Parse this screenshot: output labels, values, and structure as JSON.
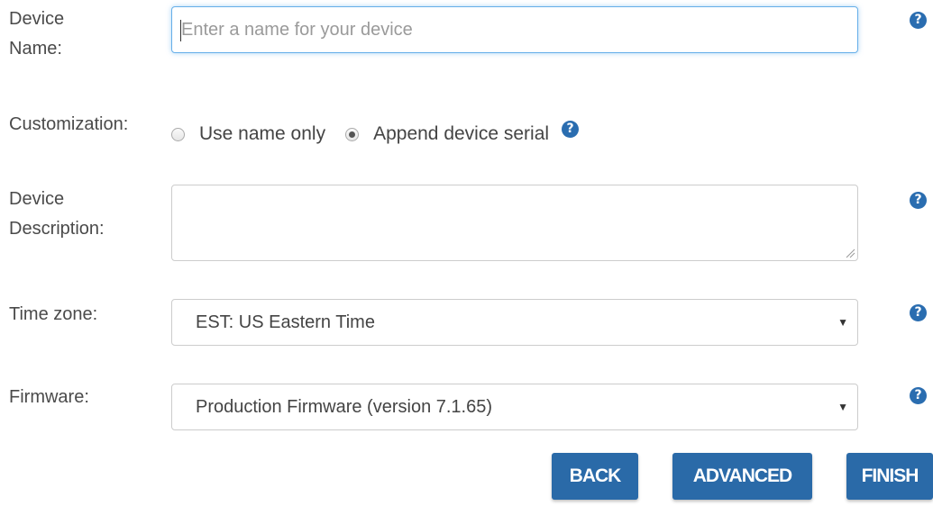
{
  "form": {
    "device_name": {
      "label_line1": "Device",
      "label_line2": "Name:",
      "placeholder": "Enter a name for your device",
      "value": ""
    },
    "customization": {
      "label": "Customization:",
      "options": [
        {
          "label": "Use name only",
          "checked": false
        },
        {
          "label": "Append device serial",
          "checked": true
        }
      ]
    },
    "device_description": {
      "label_line1": "Device",
      "label_line2": "Description:",
      "value": ""
    },
    "time_zone": {
      "label": "Time zone:",
      "selected": "EST: US Eastern Time"
    },
    "firmware": {
      "label": "Firmware:",
      "selected": "Production Firmware (version 7.1.65)"
    }
  },
  "icons": {
    "help": "?",
    "dropdown": "▼"
  },
  "buttons": {
    "back": "BACK",
    "advanced": "ADVANCED",
    "finish": "FINISH"
  },
  "colors": {
    "button_bg": "#2a6aa8",
    "help_icon": "#2a6db0",
    "focus_border": "#66afe9"
  }
}
